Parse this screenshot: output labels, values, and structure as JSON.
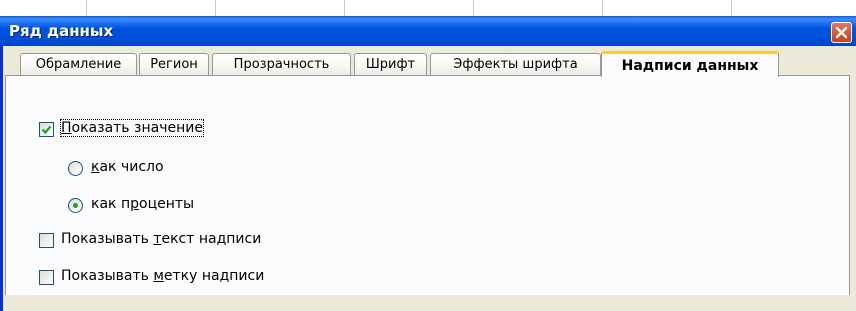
{
  "dialog": {
    "title": "Ряд данных",
    "close_icon": "close-icon"
  },
  "tabs": [
    {
      "label": "Обрамление",
      "active": false
    },
    {
      "label": "Регион",
      "active": false
    },
    {
      "label": "Прозрачность",
      "active": false
    },
    {
      "label": "Шрифт",
      "active": false
    },
    {
      "label": "Эффекты шрифта",
      "active": false
    },
    {
      "label": "Надписи данных",
      "active": true
    }
  ],
  "options": {
    "show_value": {
      "label_mnemonic": "П",
      "label_rest": "оказать значение",
      "checked": true
    },
    "as_number": {
      "label_mnemonic": "к",
      "label_rest": "ак число",
      "selected": false
    },
    "as_percent": {
      "label_prefix": "как п",
      "label_mnemonic": "р",
      "label_rest": "оценты",
      "selected": true
    },
    "show_label_text": {
      "label_prefix": "Показывать ",
      "label_mnemonic": "т",
      "label_rest": "екст надписи",
      "checked": false
    },
    "show_label_key": {
      "label_prefix": "Показывать ",
      "label_mnemonic": "м",
      "label_rest": "етку надписи",
      "checked": false
    }
  },
  "colors": {
    "title_bar": "#0054e3",
    "active_tab_accent": "#ffc83c",
    "check_mark": "#21a121",
    "dialog_bg": "#ece9d8"
  }
}
